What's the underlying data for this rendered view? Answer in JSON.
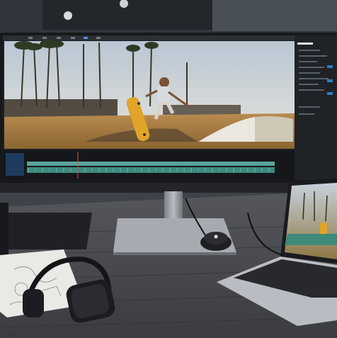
{
  "editor": {
    "panel_title": "",
    "playhead_marker": ""
  },
  "colors": {
    "wall": "#3a3f48",
    "desk": "#4b4d52",
    "sky": "#d8dde2",
    "timeline_track": "#5aa39a",
    "ui_dark": "#1a1c20"
  },
  "icons": {
    "headphones": "headphones-icon",
    "controller": "dial-controller-icon",
    "laptop": "laptop-icon"
  }
}
